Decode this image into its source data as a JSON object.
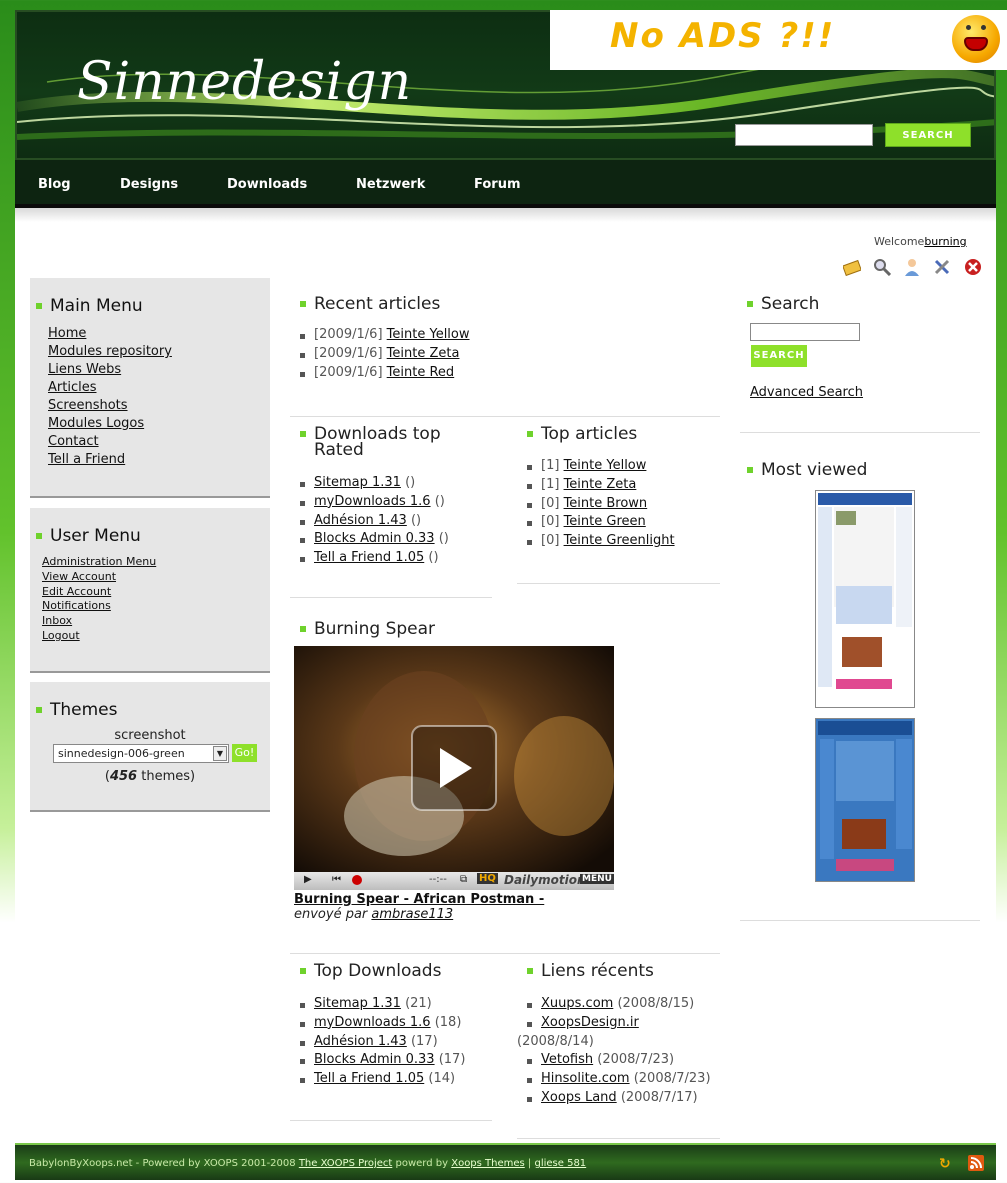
{
  "header": {
    "logo": "Sinnedesign",
    "ads_text": "No ADS ?!!",
    "search_button": "Search"
  },
  "nav": [
    "Blog",
    "Designs",
    "Downloads",
    "Netzwerk",
    "Forum"
  ],
  "user_bar": {
    "welcome": "Welcome",
    "username": "burning",
    "icons": [
      "inbox-icon",
      "search-icon",
      "user-icon",
      "admin-tools-icon",
      "logout-icon"
    ]
  },
  "main_menu": {
    "title": "Main Menu",
    "items": [
      "Home",
      "Modules repository",
      "Liens Webs",
      "Articles",
      "Screenshots",
      "Modules Logos",
      "Contact",
      "Tell a Friend"
    ]
  },
  "user_menu": {
    "title": "User Menu",
    "items": [
      "Administration Menu",
      "View Account",
      "Edit Account",
      "Notifications",
      "Inbox",
      "Logout"
    ]
  },
  "themes": {
    "title": "Themes",
    "caption": "screenshot",
    "selected": "sinnedesign-006-green",
    "go": "Go!",
    "count_prefix": "(",
    "count": "456",
    "count_suffix": " themes)"
  },
  "recent_articles": {
    "title": "Recent articles",
    "items": [
      {
        "date": "[2009/1/6]",
        "title": "Teinte Yellow"
      },
      {
        "date": "[2009/1/6]",
        "title": "Teinte Zeta"
      },
      {
        "date": "[2009/1/6]",
        "title": "Teinte Red"
      }
    ]
  },
  "downloads_top_rated": {
    "title": "Downloads top Rated",
    "items": [
      {
        "name": "Sitemap 1.31",
        "extra": "()"
      },
      {
        "name": "myDownloads 1.6",
        "extra": "()"
      },
      {
        "name": "Adhésion 1.43",
        "extra": "()"
      },
      {
        "name": "Blocks Admin 0.33",
        "extra": "()"
      },
      {
        "name": "Tell a Friend 1.05",
        "extra": "()"
      }
    ]
  },
  "top_articles": {
    "title": "Top articles",
    "items": [
      {
        "rank": "[1]",
        "title": "Teinte Yellow"
      },
      {
        "rank": "[1]",
        "title": "Teinte Zeta"
      },
      {
        "rank": "[0]",
        "title": "Teinte Brown"
      },
      {
        "rank": "[0]",
        "title": "Teinte Green"
      },
      {
        "rank": "[0]",
        "title": "Teinte Greenlight"
      }
    ]
  },
  "video": {
    "title": "Burning Spear",
    "caption_link": "Burning Spear - African Postman -",
    "sent_by": "envoyé par ",
    "author": "ambrase113",
    "time": "--:--",
    "hq": "HQ",
    "brand": "Dailymotion",
    "menu": "MENU"
  },
  "top_downloads": {
    "title": "Top Downloads",
    "items": [
      {
        "name": "Sitemap 1.31",
        "count": "(21)"
      },
      {
        "name": "myDownloads 1.6",
        "count": "(18)"
      },
      {
        "name": "Adhésion 1.43",
        "count": "(17)"
      },
      {
        "name": "Blocks Admin 0.33",
        "count": "(17)"
      },
      {
        "name": "Tell a Friend 1.05",
        "count": "(14)"
      }
    ]
  },
  "recent_links": {
    "title": "Liens récents",
    "items": [
      {
        "name": "Xuups.com",
        "date": "(2008/8/15)"
      },
      {
        "name": "XoopsDesign.ir",
        "date": "(2008/8/14)"
      },
      {
        "name": "Vetofish",
        "date": "(2008/7/23)"
      },
      {
        "name": "Hinsolite.com",
        "date": "(2008/7/23)"
      },
      {
        "name": "Xoops Land",
        "date": "(2008/7/17)"
      }
    ]
  },
  "search_block": {
    "title": "Search",
    "button": "Search",
    "advanced": "Advanced Search"
  },
  "most_viewed": {
    "title": "Most viewed"
  },
  "footer": {
    "text1": "BabylonByXoops.net - Powered by XOOPS 2001-2008 ",
    "link1": "The XOOPS Project",
    "text2": " powerd by ",
    "link2": "Xoops Themes",
    "text3": " | ",
    "link3": "gliese 581"
  },
  "colors": {
    "accent_green": "#8ee02a",
    "header_dark": "#123a17",
    "nav_dark": "#0d2411"
  }
}
